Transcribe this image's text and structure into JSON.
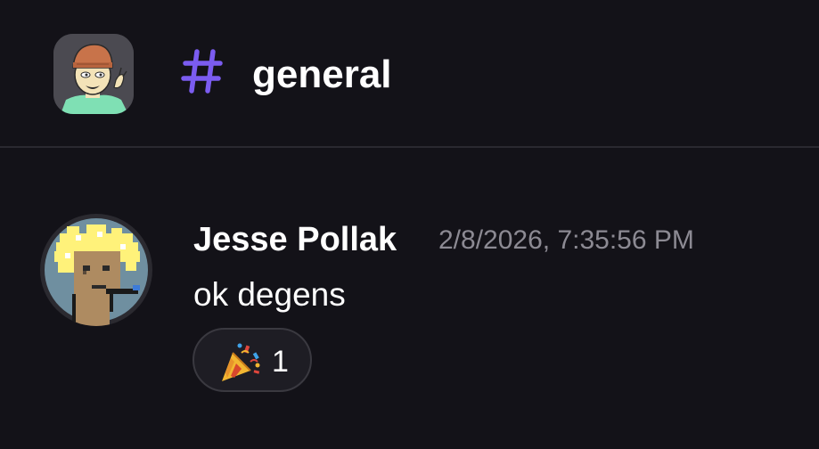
{
  "channel": {
    "icon": "hash-icon",
    "name": "general",
    "accent_color": "#7b5cf0"
  },
  "server": {
    "icon": "server-avatar"
  },
  "message": {
    "author": "Jesse Pollak",
    "timestamp": "2/8/2026, 7:35:56 PM",
    "text": "ok degens",
    "reaction": {
      "emoji": "party-popper-icon",
      "count": "1"
    }
  },
  "colors": {
    "background": "#131218",
    "divider": "#2a2930",
    "muted_text": "#8c8a93"
  }
}
